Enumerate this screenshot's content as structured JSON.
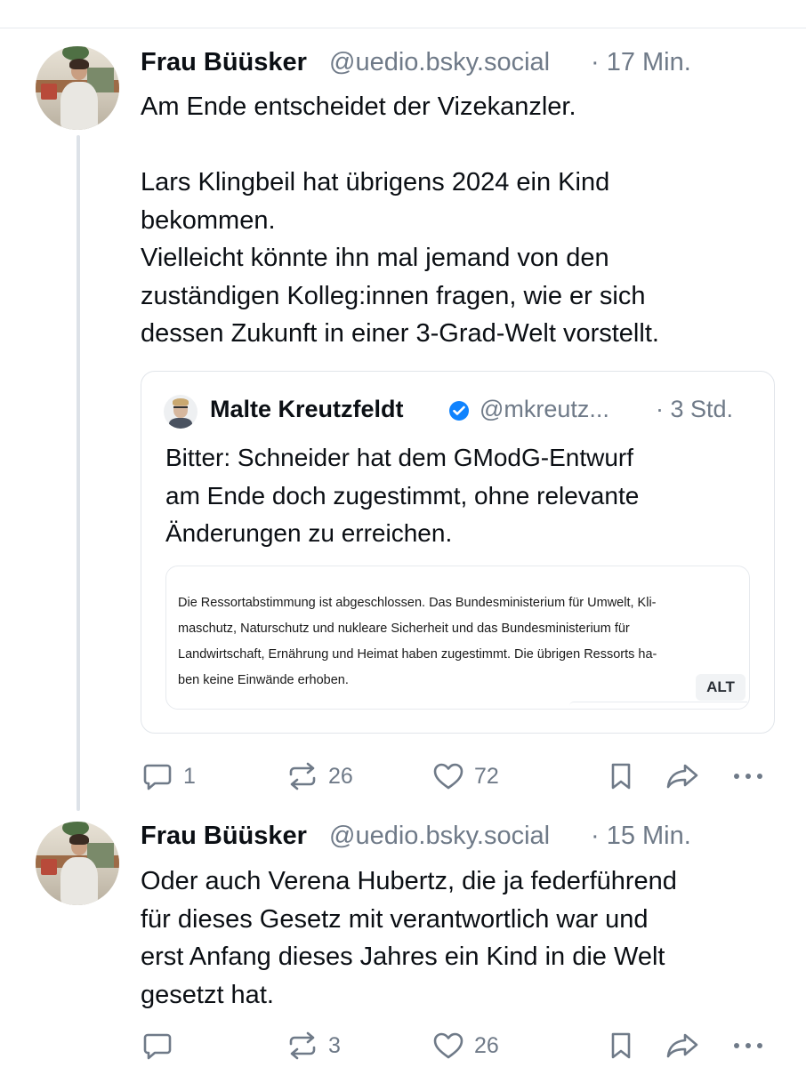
{
  "colors": {
    "text": "#0b0f14",
    "muted": "#6f7a88",
    "thread_line": "#dde2e8",
    "verified": "#1083fe",
    "card_border": "#e1e5ea"
  },
  "posts": [
    {
      "author": "Frau Büüsker",
      "handle": "@uedio.bsky.social",
      "time": "· 17 Min.",
      "text": "Am Ende entscheidet der Vizekanzler.\n\nLars Klingbeil hat übrigens 2024 ein Kind\nbekommen.\nVielleicht könnte ihn mal jemand von den\nzuständigen Kolleg:innen fragen, wie er sich\ndessen Zukunft in einer 3-Grad-Welt vorstellt.",
      "quote": {
        "author": "Malte Kreutzfeldt",
        "verified_icon": "verified-check-icon",
        "handle": "@mkreutz...",
        "time": "· 3 Std.",
        "text": "Bitter: Schneider hat dem GModG-Entwurf\nam Ende doch zugestimmt, ohne relevante\nÄnderungen zu erreichen.",
        "image_text": "Die Ressortabstimmung ist abgeschlossen. Das Bundesministerium für Umwelt, Kli-\nmaschutz, Naturschutz und nukleare Sicherheit und das Bundesministerium für\nLandwirtschaft, Ernährung und Heimat haben zugestimmt. Die übrigen Ressorts ha-\nben keine Einwände erhoben.",
        "alt_label": "ALT"
      },
      "actions": {
        "replies": "1",
        "reposts": "26",
        "likes": "72"
      }
    },
    {
      "author": "Frau Büüsker",
      "handle": "@uedio.bsky.social",
      "time": "· 15 Min.",
      "text": "Oder auch Verena Hubertz, die ja federführend\nfür dieses Gesetz mit verantwortlich war und\nerst Anfang dieses Jahres ein Kind in die Welt\ngesetzt hat.",
      "actions": {
        "replies": "",
        "reposts": "3",
        "likes": "26"
      }
    }
  ],
  "icons": [
    "reply-icon",
    "repost-icon",
    "like-icon",
    "bookmark-icon",
    "share-icon",
    "more-icon"
  ]
}
